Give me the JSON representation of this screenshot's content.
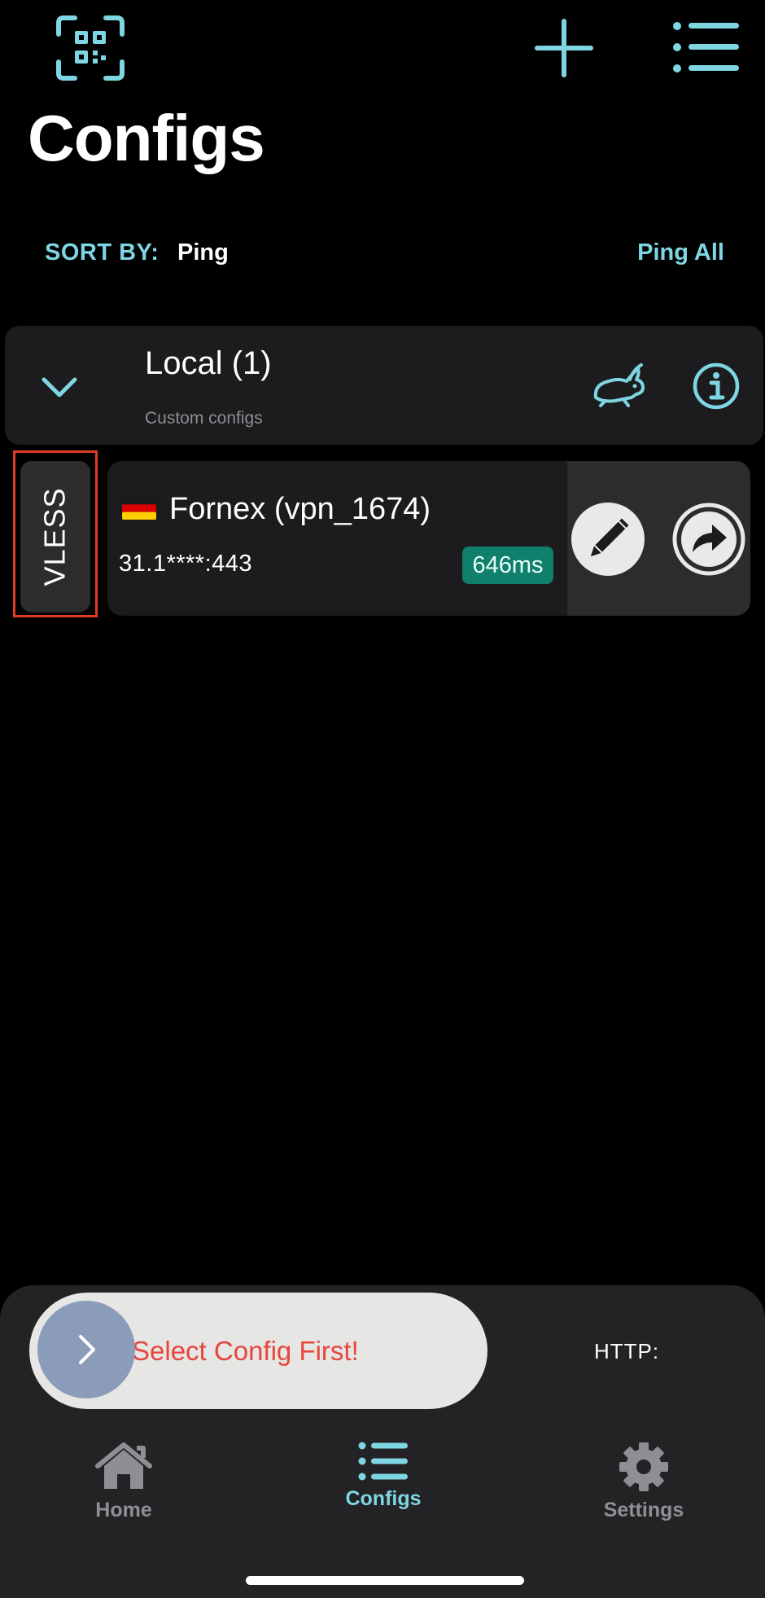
{
  "header": {
    "title": "Configs",
    "icons": {
      "scan": "qr-scan-icon",
      "add": "plus-icon",
      "menu": "list-icon"
    }
  },
  "sort": {
    "label": "SORT BY:",
    "value": "Ping",
    "ping_all": "Ping All"
  },
  "group": {
    "name": "Local (1)",
    "subtitle": "Custom configs"
  },
  "config": {
    "protocol": "VLESS",
    "name": "Fornex (vpn_1674)",
    "address": "31.1****:443",
    "ping": "646ms"
  },
  "connect": {
    "status": "Select Config First!",
    "http_label": "HTTP:"
  },
  "tabs": [
    {
      "label": "Home"
    },
    {
      "label": "Configs"
    },
    {
      "label": "Settings"
    }
  ],
  "colors": {
    "accent": "#7fd6e3",
    "ping_badge": "#10806c",
    "error_text": "#e8453c",
    "highlight_frame": "#e03b24"
  }
}
